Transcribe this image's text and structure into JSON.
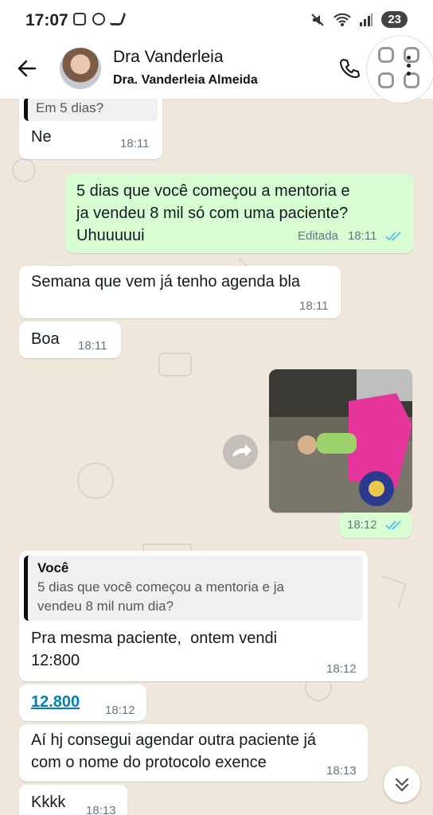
{
  "status": {
    "time": "17:07",
    "battery": "23"
  },
  "header": {
    "title": "Dra Vanderleia",
    "subtitle": "Dra. Vanderleia Almeida"
  },
  "messages": {
    "m0": {
      "quote": "Em 5 dias?",
      "text": "Ne",
      "time": "18:11"
    },
    "m1": {
      "text": "5 dias que você começou a mentoria e\nja vendeu 8 mil só com uma paciente?\nUhuuuuui",
      "edited": "Editada",
      "time": "18:11"
    },
    "m2": {
      "text": "Semana que vem já tenho agenda bla",
      "time": "18:11"
    },
    "m3": {
      "text": "Boa",
      "time": "18:11"
    },
    "m4": {
      "time": "18:12",
      "media": "photo"
    },
    "m5": {
      "quote_name": "Você",
      "quote_text": "5 dias que você começou a mentoria e ja\nvendeu 8 mil num dia?",
      "text": "Pra mesma paciente,  ontem vendi\n12:800",
      "time": "18:12"
    },
    "m6": {
      "text": "12.800",
      "time": "18:12"
    },
    "m7": {
      "text": "Aí hj consegui agendar outra paciente já\ncom o nome do protocolo exence",
      "time": "18:13"
    },
    "m8": {
      "text": "Kkkk",
      "time": "18:13"
    }
  },
  "colors": {
    "incoming": "#ffffff",
    "outgoing": "#d9fdd3",
    "read_ticks": "#53bdeb",
    "link": "#027eb5"
  },
  "icons": [
    "back-arrow-icon",
    "phone-icon",
    "kebab-menu-icon",
    "forward-icon",
    "read-ticks-icon",
    "scroll-down-icon"
  ]
}
